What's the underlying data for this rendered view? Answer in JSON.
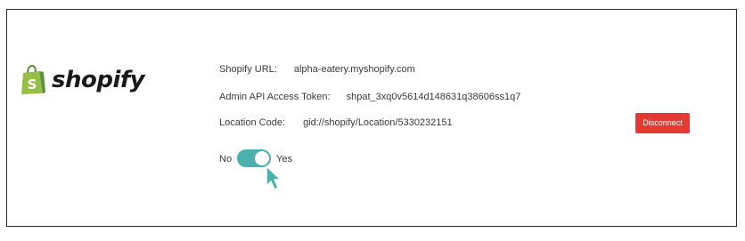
{
  "brand": {
    "name": "shopify",
    "colors": {
      "bag": "#95bf47",
      "bag_dark": "#5e8e3e"
    }
  },
  "fields": {
    "url": {
      "label": "Shopify URL:",
      "value": "alpha-eatery.myshopify.com"
    },
    "token": {
      "label": "Admin API Access Token:",
      "value": "shpat_3xq0v5614d148631q38606ss1q7"
    },
    "location": {
      "label": "Location Code:",
      "value": "gid://shopify/Location/5330232151"
    }
  },
  "actions": {
    "disconnect_label": "Disconnect",
    "disconnect_color": "#e53935"
  },
  "toggle": {
    "off_label": "No",
    "on_label": "Yes",
    "state": "on",
    "color": "#4cb0ad"
  },
  "cursor": {
    "icon": "hand-pointer-icon",
    "color": "#4cb0ad"
  }
}
